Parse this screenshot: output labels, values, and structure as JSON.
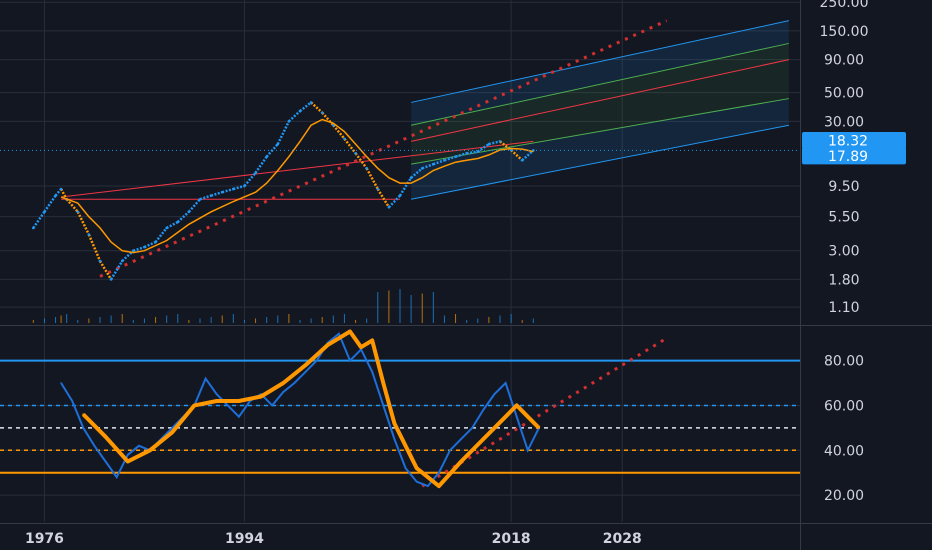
{
  "colors": {
    "background": "#131722",
    "grid": "#2a2e39",
    "axis_text": "#d1d4dc",
    "price_up": "#2196f3",
    "price_down": "#ff9800",
    "moving_average": "#ff9800",
    "channel_outer": "#2196f3",
    "channel_inner": "#4caf50",
    "channel_mid": "#f23645",
    "dotted_trend": "#d32f2f",
    "rsi_line": "#1e6fd9",
    "rsi_ma": "#ff9800",
    "overbought": "#2196f3",
    "oversold": "#ff9800",
    "badge": "#2196f3"
  },
  "chart_data": [
    {
      "type": "line",
      "panel": "price",
      "y_scale": "log",
      "ylim": [
        0.8,
        260
      ],
      "xlim": [
        1972,
        2044
      ],
      "grid": true,
      "yticks": [
        "250.00",
        "150.00",
        "90.00",
        "50.00",
        "30.00",
        "9.50",
        "5.50",
        "3.00",
        "1.80",
        "1.10"
      ],
      "ytick_values": [
        250,
        150,
        90,
        50,
        30,
        9.5,
        5.5,
        3.0,
        1.8,
        1.1
      ],
      "price_badges": [
        "18.32",
        "17.89"
      ],
      "price_badge_values": [
        18.32,
        17.89
      ],
      "series": [
        {
          "values_x": [
            1975.0,
            1976.0,
            1977.0,
            1977.5,
            1978.0,
            1979.0,
            1980.0,
            1981.0,
            1982.0,
            1983.0,
            1984.0,
            1985.0,
            1986.0,
            1987.0,
            1988.0,
            1989.0,
            1990.0,
            1991.0,
            1992.0,
            1993.0,
            1994.0,
            1995.0,
            1996.0,
            1997.0,
            1998.0,
            1999.0,
            2000.0,
            2001.0,
            2002.0,
            2003.0,
            2004.0,
            2005.0,
            2006.0,
            2007.0,
            2008.0,
            2009.0,
            2010.0,
            2011.0,
            2012.0,
            2013.0,
            2014.0,
            2015.0,
            2016.0,
            2017.0,
            2018.0,
            2019.0,
            2020.0
          ],
          "values_y": [
            4.5,
            6.0,
            8.0,
            9.0,
            7.5,
            6.0,
            4.0,
            2.5,
            1.8,
            2.5,
            3.0,
            3.2,
            3.5,
            4.5,
            5.0,
            6.0,
            7.5,
            8.0,
            8.5,
            9.0,
            9.5,
            12.0,
            16.0,
            20.0,
            30.0,
            36.0,
            42.0,
            35.0,
            28.0,
            22.0,
            17.0,
            13.0,
            9.0,
            6.5,
            8.0,
            11.0,
            13.0,
            14.0,
            15.0,
            16.0,
            17.0,
            17.5,
            20.0,
            21.0,
            18.0,
            15.0,
            17.89
          ]
        },
        {
          "name": "",
          "values_x": [
            1977.5,
            1979.0,
            1980.0,
            1981.0,
            1982.0,
            1983.0,
            1984.0,
            1985.0,
            1987.0,
            1989.0,
            1991.0,
            1993.0,
            1995.0,
            1996.0,
            1997.0,
            1998.0,
            1999.0,
            2000.0,
            2001.0,
            2002.0,
            2003.0,
            2004.0,
            2005.0,
            2006.0,
            2007.0,
            2008.0,
            2009.0,
            2010.0,
            2011.0,
            2012.0,
            2013.0,
            2014.0,
            2015.0,
            2016.0,
            2017.0,
            2018.0,
            2019.0,
            2020.0
          ],
          "values_y": [
            7.8,
            7.0,
            5.5,
            4.5,
            3.5,
            3.0,
            2.9,
            3.0,
            3.6,
            4.8,
            6.0,
            7.2,
            8.5,
            10.0,
            12.5,
            16.0,
            21.0,
            28.0,
            31.0,
            29.0,
            25.0,
            20.0,
            16.0,
            13.0,
            11.0,
            10.0,
            10.0,
            11.0,
            12.5,
            13.5,
            14.5,
            15.0,
            15.5,
            16.5,
            18.0,
            18.5,
            18.32,
            17.5
          ]
        }
      ],
      "channel": {
        "start_x": 2009.0,
        "end_x": 2043.0,
        "mid_start": 21.0,
        "mid_end": 90.0,
        "outer_upper_start": 42.0,
        "outer_upper_end": 180.0,
        "outer_lower_start": 7.5,
        "outer_lower_end": 28.0,
        "inner_upper_start": 28.0,
        "inner_upper_end": 120.0,
        "inner_lower_start": 14.0,
        "inner_lower_end": 45.0
      },
      "reference_lines": [
        {
          "from_x": 1977.5,
          "to_x": 2020.0,
          "from_y": 7.8,
          "to_y": 21.0
        },
        {
          "from_x": 1977.5,
          "to_x": 2008.0,
          "from_y": 7.5,
          "to_y": 7.5
        }
      ],
      "dotted_trend": {
        "from_x": 1981.0,
        "to_x": 2032.0,
        "from_y": 1.9,
        "to_y": 180.0
      }
    },
    {
      "type": "line",
      "panel": "oscillator",
      "ylim": [
        8,
        95
      ],
      "xlim": [
        1972,
        2044
      ],
      "grid": true,
      "yticks": [
        "80.00",
        "60.00",
        "40.00",
        "20.00"
      ],
      "ytick_values": [
        80,
        60,
        40,
        20
      ],
      "levels": {
        "upper": 80,
        "upper_dashed": 60,
        "middle": 50,
        "lower_dashed": 40,
        "lower": 30
      },
      "series": [
        {
          "values_x": [
            1977.5,
            1978.5,
            1979.5,
            1980.5,
            1981.5,
            1982.5,
            1983.5,
            1984.5,
            1985.5,
            1986.5,
            1987.5,
            1988.5,
            1989.5,
            1990.5,
            1991.5,
            1992.5,
            1993.5,
            1994.5,
            1995.5,
            1996.5,
            1997.5,
            1998.5,
            1999.5,
            2000.5,
            2001.5,
            2002.5,
            2003.5,
            2004.5,
            2005.5,
            2006.5,
            2007.5,
            2008.5,
            2009.5,
            2010.5,
            2011.5,
            2012.5,
            2013.5,
            2014.5,
            2015.5,
            2016.5,
            2017.5,
            2018.5,
            2019.5,
            2020.5
          ],
          "values_y": [
            70,
            62,
            50,
            42,
            35,
            28,
            38,
            42,
            40,
            45,
            50,
            55,
            60,
            72,
            65,
            60,
            55,
            62,
            65,
            60,
            66,
            70,
            75,
            80,
            88,
            92,
            80,
            85,
            75,
            60,
            45,
            32,
            26,
            24,
            30,
            40,
            45,
            50,
            58,
            65,
            70,
            55,
            40,
            50
          ]
        },
        {
          "name": "",
          "values_x": [
            1979.5,
            1981.5,
            1983.5,
            1985.5,
            1987.5,
            1989.5,
            1991.5,
            1993.5,
            1995.5,
            1997.5,
            1999.5,
            2001.5,
            2003.5,
            2004.5,
            2005.5,
            2006.5,
            2007.5,
            2009.5,
            2011.5,
            2013.5,
            2015.5,
            2017.5,
            2018.5,
            2019.5,
            2020.5
          ],
          "values_y": [
            56,
            46,
            35,
            40,
            48,
            60,
            62,
            62,
            64,
            70,
            78,
            87,
            93,
            86,
            89,
            70,
            52,
            32,
            24,
            35,
            45,
            55,
            60,
            55,
            50
          ]
        }
      ],
      "dotted_trend": {
        "from_x": 2010.0,
        "to_x": 2032.0,
        "from_y": 24.0,
        "to_y": 90.0
      }
    }
  ],
  "x_axis": {
    "labels": [
      "1976",
      "1994",
      "2018",
      "2028"
    ],
    "values": [
      1976,
      1994,
      2018,
      2028
    ]
  }
}
